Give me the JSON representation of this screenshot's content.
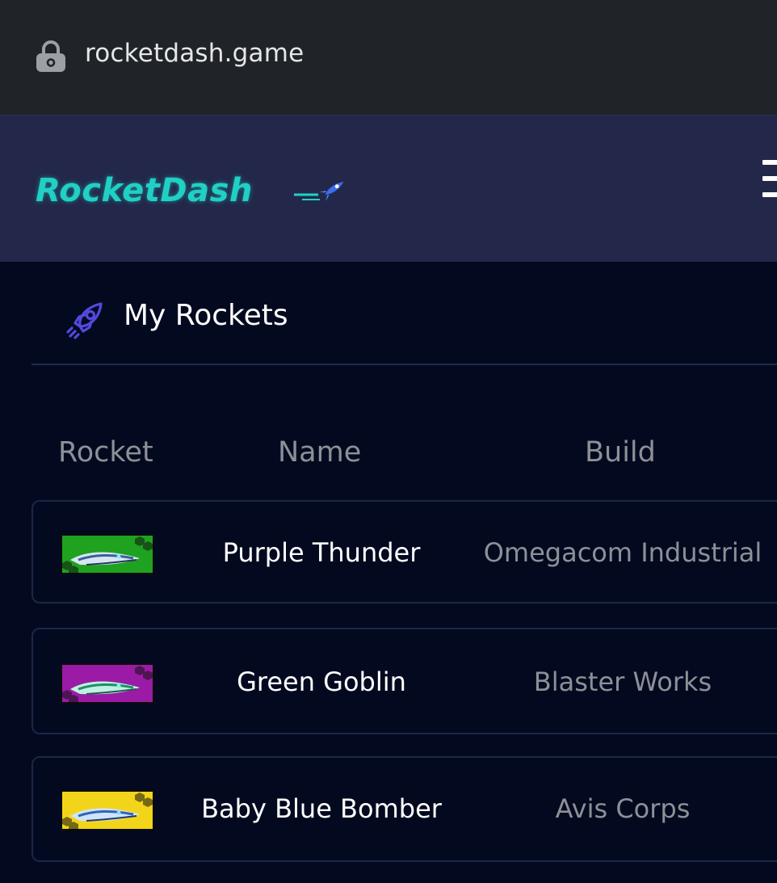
{
  "browser": {
    "url": "rocketdash.game",
    "lock_icon": "lock-icon"
  },
  "header": {
    "logo_text": "RocketDash",
    "logo_color": "#20d0c4",
    "menu_icon": "hamburger-menu-icon"
  },
  "section": {
    "title": "My Rockets",
    "icon": "rocket-icon"
  },
  "table": {
    "columns": [
      "Rocket",
      "Name",
      "Build"
    ],
    "rows": [
      {
        "name": "Purple Thunder",
        "build": "Omegacom Industrial",
        "thumb_bg": "#1fa21f"
      },
      {
        "name": "Green Goblin",
        "build": "Blaster Works",
        "thumb_bg": "#9b1ba6"
      },
      {
        "name": "Baby Blue Bomber",
        "build": "Avis Corps",
        "thumb_bg": "#f2d51a"
      }
    ]
  },
  "colors": {
    "url_bar": "#202327",
    "header_bg": "#23284a",
    "page_bg": "#030a20",
    "muted_text": "#8d9096"
  }
}
